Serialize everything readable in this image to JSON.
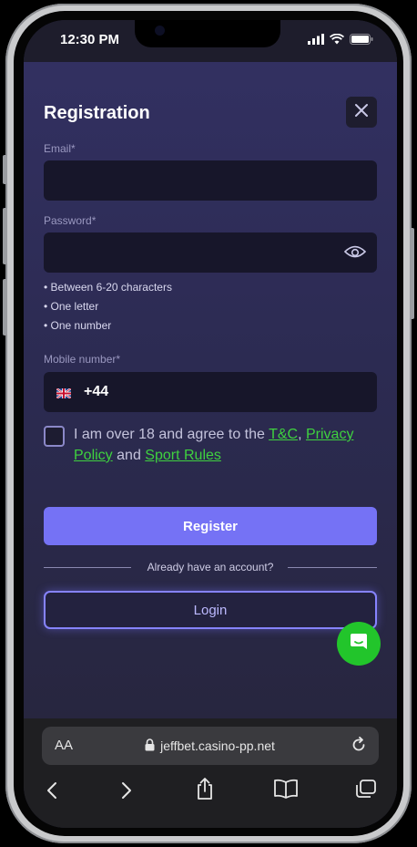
{
  "status": {
    "time": "12:30 PM"
  },
  "registration": {
    "title": "Registration",
    "email_label": "Email*",
    "email_value": "",
    "password_label": "Password*",
    "password_value": "",
    "password_rules": [
      "• Between 6-20 characters",
      "• One letter",
      "• One number"
    ],
    "mobile_label": "Mobile number*",
    "mobile_prefix": "+44",
    "agree_prefix": "I am over 18 and agree to the",
    "tc_link": "T&C",
    "agree_comma": ",",
    "privacy_link": "Privacy Policy",
    "agree_and": "and",
    "sport_link": "Sport Rules",
    "register_label": "Register",
    "divider_text": "Already have an account?",
    "login_label": "Login"
  },
  "browser": {
    "aa_label": "AA",
    "url": "jeffbet.casino-pp.net"
  },
  "icons": {
    "close": "close-icon",
    "eye": "eye-icon",
    "flag": "uk-flag-icon",
    "chat": "chat-icon",
    "lock": "lock-icon",
    "reload": "reload-icon",
    "back": "back-icon",
    "forward": "forward-icon",
    "share": "share-icon",
    "bookmarks": "bookmarks-icon",
    "tabs": "tabs-icon"
  },
  "colors": {
    "accent": "#7572f5",
    "link": "#3fd13f",
    "chat": "#22c52b",
    "background": "#2b2a4f"
  }
}
